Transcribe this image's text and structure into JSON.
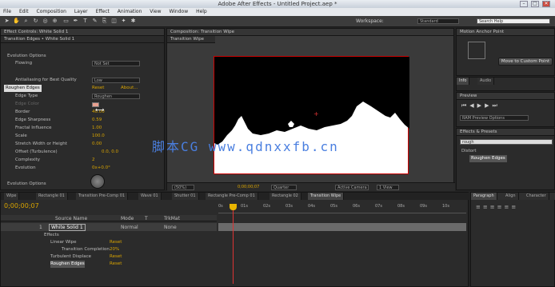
{
  "window": {
    "title": "Adobe After Effects - Untitled Project.aep *",
    "min": "–",
    "max": "□",
    "close": "✕"
  },
  "menu": [
    "File",
    "Edit",
    "Composition",
    "Layer",
    "Effect",
    "Animation",
    "View",
    "Window",
    "Help"
  ],
  "toolbar": {
    "workspace_label": "Workspace:",
    "workspace_value": "Standard",
    "search_placeholder": "Search Help"
  },
  "effect_controls": {
    "tab": "Effect Controls: White Solid 1",
    "breadcrumb": "Transition Edges • White Solid 1",
    "rows": [
      {
        "label": "Evolution Options",
        "value": ""
      },
      {
        "label": "Flowing",
        "value": "Not Set"
      },
      {
        "label": "Antialiasing for Best Quality",
        "value": "Low"
      },
      {
        "label": "Roughen Edges",
        "value": "Reset",
        "value2": "About..."
      },
      {
        "label": "Edge Type",
        "value": "Roughen"
      },
      {
        "label": "Edge Color",
        "value": ""
      },
      {
        "label": "Border",
        "value": "40.00"
      },
      {
        "label": "Edge Sharpness",
        "value": "0.59"
      },
      {
        "label": "Fractal Influence",
        "value": "1.00"
      },
      {
        "label": "Scale",
        "value": "100.0"
      },
      {
        "label": "Stretch Width or Height",
        "value": "0.00"
      },
      {
        "label": "Offset (Turbulence)",
        "value": "0.0, 0.0"
      },
      {
        "label": "Complexity",
        "value": "2"
      },
      {
        "label": "Evolution",
        "value": "0x+0.0°"
      },
      {
        "label": "Evolution Options",
        "value": ""
      }
    ]
  },
  "comp": {
    "tab": "Composition: Transition Wipe",
    "subtab": "Transition Wipe",
    "zoom": "(50%)",
    "time": "0;00;00;07",
    "quality": "Quarter",
    "camera": "Active Camera",
    "views": "1 View"
  },
  "watermark": "脚本CG  www.qdnxxfb.cn",
  "right": {
    "align_tab": "Motion Anchor Point",
    "align_btn": "Move to Custom Point",
    "info_tabs": [
      "Info",
      "Audio"
    ],
    "preview_tab": "Preview",
    "ram_label": "RAM Preview Options",
    "effects_tab": "Effects & Presets",
    "search_value": "rough",
    "tree": [
      "Distort",
      "Roughen Edges"
    ]
  },
  "timeline": {
    "tabs": [
      "Wipe",
      "Rectangle 01",
      "Transition Pre-Comp 01",
      "Wave 01",
      "Shutter 01",
      "Rectangle Pre-Comp 01",
      "Rectangle 02",
      "Transition Wipe"
    ],
    "timecode": "0;00;00;07",
    "headers": [
      "Source Name",
      "Mode",
      "T",
      "TrkMat"
    ],
    "layer": {
      "num": "1",
      "name": "White Solid 1",
      "mode": "Normal",
      "trk": "None"
    },
    "rows": [
      {
        "label": "Effects",
        "value": ""
      },
      {
        "label": "Linear Wipe",
        "value": "Reset"
      },
      {
        "label": "Transition Completion",
        "value": "20%"
      },
      {
        "label": "Turbulent Displace",
        "value": "Reset"
      },
      {
        "label": "Roughen Edges",
        "value": "Reset"
      }
    ],
    "ruler": [
      "0s",
      "01s",
      "02s",
      "03s",
      "04s",
      "05s",
      "06s",
      "07s",
      "08s",
      "09s",
      "10s"
    ],
    "paragraph_tab": "Paragraph",
    "align2": "Align",
    "char": "Character"
  }
}
